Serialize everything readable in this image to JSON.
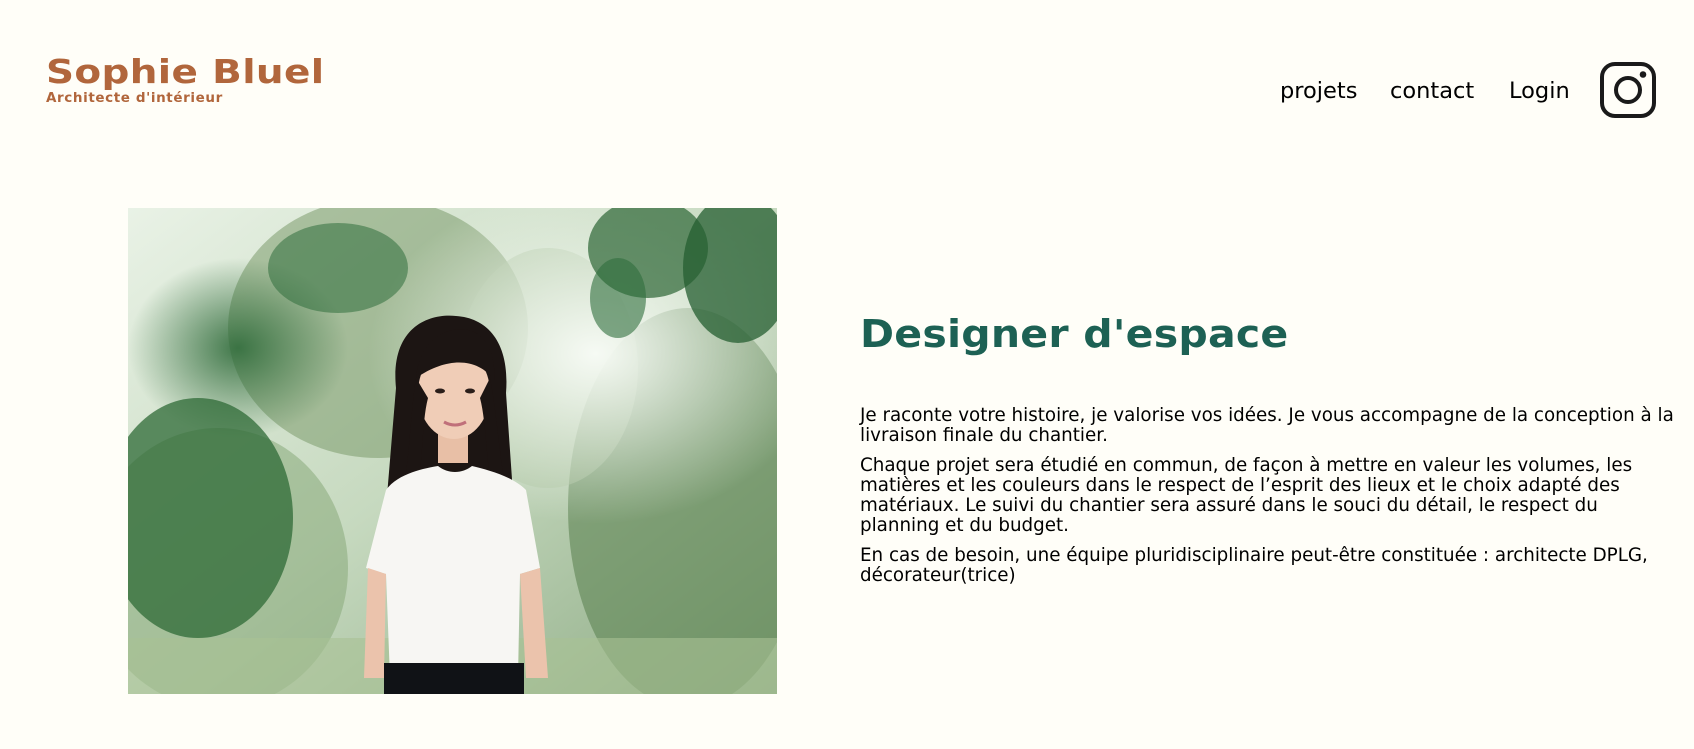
{
  "header": {
    "logo_name": "Sophie Bluel",
    "logo_subtitle": "Architecte d'intérieur",
    "nav": {
      "projets": "projets",
      "contact": "contact",
      "login": "Login"
    },
    "social_icon": "instagram-icon"
  },
  "intro": {
    "photo_description": "portrait-photo",
    "title": "Designer d'espace",
    "paragraphs": [
      "Je raconte votre histoire, je valorise vos idées. Je vous accompagne de la conception à la livraison finale du chantier.",
      "Chaque projet sera étudié en commun, de façon à mettre en valeur les volumes, les matières et les couleurs dans le respect de l’esprit des lieux et le choix adapté des matériaux. Le suivi du chantier sera assuré dans le souci du détail, le respect du planning et du budget.",
      "En cas de besoin, une équipe pluridisciplinaire peut-être constituée : architecte DPLG, décorateur(trice)"
    ]
  },
  "colors": {
    "background": "#FFFEF8",
    "brand": "#B1663C",
    "title": "#1D6154",
    "text": "#000000"
  }
}
